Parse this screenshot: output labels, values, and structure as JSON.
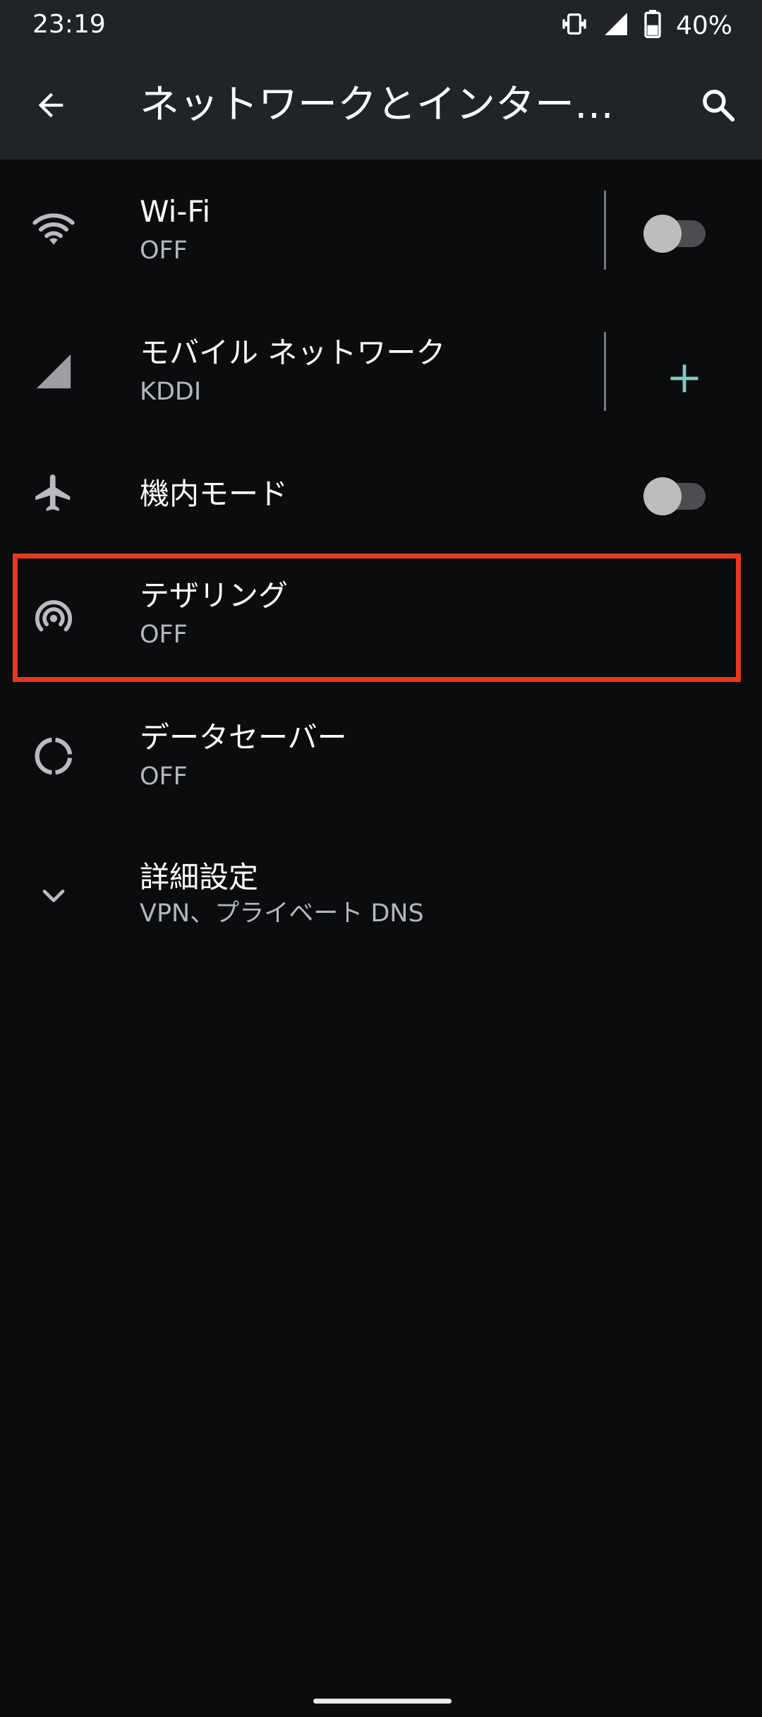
{
  "status_bar": {
    "time": "23:19",
    "battery": "40%",
    "icons": [
      "vibrate-icon",
      "cell-signal-icon",
      "battery-icon"
    ]
  },
  "app_bar": {
    "title": "ネットワークとインターネ…",
    "back_icon": "arrow-back-icon",
    "search_icon": "search-icon"
  },
  "settings": {
    "wifi": {
      "title": "Wi-Fi",
      "summary": "OFF",
      "icon": "wifi-icon",
      "enabled": false
    },
    "mobile": {
      "title": "モバイル ネットワーク",
      "summary": "KDDI",
      "icon": "cell-signal-icon",
      "action_icon": "plus-icon"
    },
    "airplane": {
      "title": "機内モード",
      "icon": "airplane-icon",
      "enabled": false
    },
    "tethering": {
      "title": "テザリング",
      "summary": "OFF",
      "icon": "hotspot-icon"
    },
    "data_saver": {
      "title": "データセーバー",
      "summary": "OFF",
      "icon": "data-saver-icon"
    },
    "advanced": {
      "title": "詳細設定",
      "summary": "VPN、プライベート DNS",
      "icon": "chevron-down-icon"
    }
  },
  "colors": {
    "background": "#0b0c0e",
    "app_bar": "#202328",
    "accent": "#7fcbc4",
    "highlight": "#e7391f",
    "summary_text": "#b4b7bc"
  }
}
